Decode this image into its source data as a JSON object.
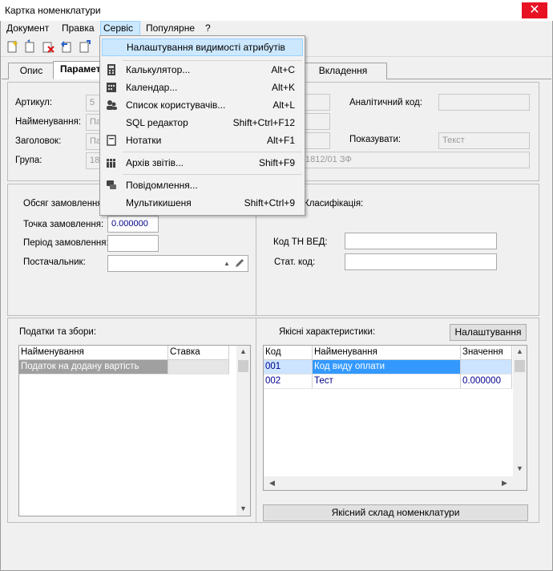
{
  "window": {
    "title": "Картка номенклатури",
    "close_glyph": "✕"
  },
  "menubar": {
    "items": [
      "Документ",
      "Правка",
      "Сервіс",
      "Популярне",
      "?"
    ]
  },
  "tabs": [
    "Опис",
    "Параметри",
    "Вкладення"
  ],
  "service_menu": {
    "items": [
      {
        "label": "Налаштування видимості атрибутів",
        "shortcut": "",
        "icon": ""
      },
      {
        "label": "Калькулятор...",
        "shortcut": "Alt+C",
        "icon": "calculator-icon"
      },
      {
        "label": "Календар...",
        "shortcut": "Alt+K",
        "icon": "calendar-icon"
      },
      {
        "label": "Список користувачів...",
        "shortcut": "Alt+L",
        "icon": "users-icon"
      },
      {
        "label": "SQL редактор",
        "shortcut": "Shift+Ctrl+F12",
        "icon": ""
      },
      {
        "label": "Нотатки",
        "shortcut": "Alt+F1",
        "icon": "notes-icon"
      },
      {
        "label": "Архів звітів...",
        "shortcut": "Shift+F9",
        "icon": "report-archive-icon"
      },
      {
        "label": "Повідомлення...",
        "shortcut": "",
        "icon": "message-icon"
      },
      {
        "label": "Мультикишеня",
        "shortcut": "Shift+Ctrl+9",
        "icon": ""
      }
    ]
  },
  "general": {
    "article_label": "Артикул:",
    "article_value": "5",
    "name_label": "Найменування:",
    "name_value": "Па",
    "heading_label": "Заголовок:",
    "heading_value": "Па",
    "group_label": "Група:",
    "group_value": "18",
    "group_code": "1812/01 ЗФ",
    "analytic_label": "Аналітичний код:",
    "show_label": "Показувати:",
    "show_value": "Текст"
  },
  "order": {
    "volume_label": "Обсяг замовлення:",
    "point_label": "Точка замовлення:",
    "point_value": "0.000000",
    "period_label": "Період замовлення:",
    "supplier_label": "Постачальник:",
    "classification_label": "Класифікація:",
    "tn_ved_label": "Код ТН ВЕД:",
    "stat_label": "Стат. код:"
  },
  "taxes": {
    "title": "Податки та збори:",
    "columns": [
      "Найменування",
      "Ставка"
    ],
    "rows": [
      {
        "name": "Податок на додану вартість",
        "rate": ""
      }
    ]
  },
  "quality": {
    "title": "Якісні характеристики:",
    "settings_button": "Налаштування",
    "columns": [
      "Код",
      "Найменування",
      "Значення"
    ],
    "rows": [
      {
        "code": "001",
        "name": "Код виду оплати",
        "value": ""
      },
      {
        "code": "002",
        "name": "Тест",
        "value": "0.000000"
      }
    ],
    "composition_button": "Якісний склад номенклатури"
  },
  "colors": {
    "selection": "#3399ff",
    "selected_row_gray": "#a0a0a0",
    "close": "#e81123",
    "menu_highlight": "#cce8ff"
  }
}
